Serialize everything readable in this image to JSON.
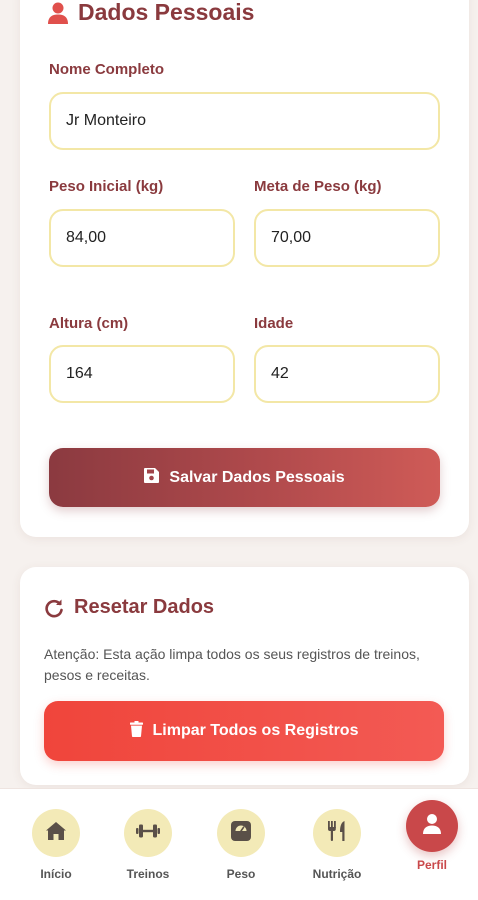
{
  "personal": {
    "title": "Dados Pessoais",
    "name_label": "Nome Completo",
    "name_value": "Jr Monteiro",
    "initial_weight_label": "Peso Inicial (kg)",
    "initial_weight_value": "84,00",
    "goal_weight_label": "Meta de Peso (kg)",
    "goal_weight_value": "70,00",
    "height_label": "Altura (cm)",
    "height_value": "164",
    "age_label": "Idade",
    "age_value": "42",
    "save_label": "Salvar Dados Pessoais"
  },
  "reset": {
    "title": "Resetar Dados",
    "warning": "Atenção: Esta ação limpa todos os seus registros de treinos, pesos e receitas.",
    "clear_label": "Limpar Todos os Registros"
  },
  "nav": {
    "items": [
      {
        "label": "Início",
        "icon": "home-icon"
      },
      {
        "label": "Treinos",
        "icon": "dumbbell-icon"
      },
      {
        "label": "Peso",
        "icon": "scale-icon"
      },
      {
        "label": "Nutrição",
        "icon": "utensils-icon"
      },
      {
        "label": "Perfil",
        "icon": "user-icon",
        "active": true
      }
    ]
  },
  "colors": {
    "primary": "#8a3a3e",
    "accent_red": "#f0453b",
    "input_border": "#f3e7a6",
    "nav_circle": "#f3eab7",
    "active": "#c9484a"
  }
}
